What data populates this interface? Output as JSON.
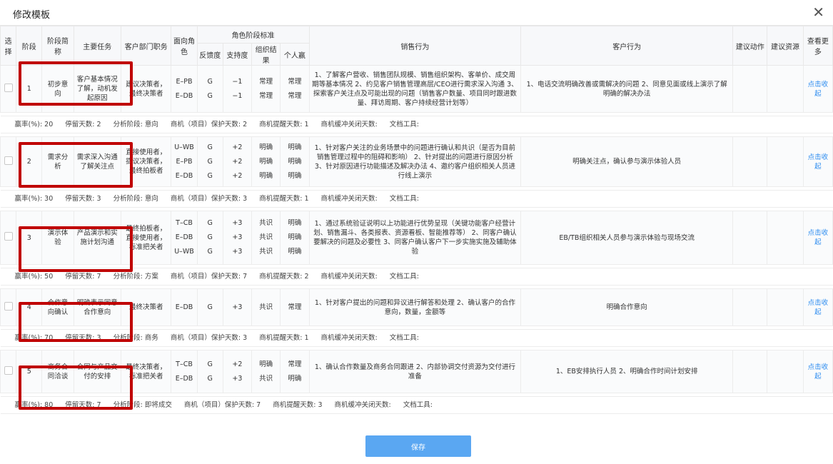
{
  "dialog": {
    "title": "修改模板",
    "close_icon": "close-icon",
    "save_label": "保存"
  },
  "headers": {
    "select": "选择",
    "stage": "阶段",
    "short_name": "阶段简称",
    "main_task": "主要任务",
    "dept_role": "客户部门职务",
    "facing_role": "面向角色",
    "role_standard": "角色阶段标准",
    "feedback": "反馈度",
    "support": "支持度",
    "org_result": "组织结果",
    "personal_win": "个人赢",
    "sales_action": "销售行为",
    "customer_action": "客户行为",
    "suggest_action": "建议动作",
    "suggest_resource": "建议资源",
    "view_more": "查看更多"
  },
  "summary_labels": {
    "win_rate": "赢率(%):",
    "stay_days": "停留天数:",
    "analysis_stage": "分析阶段:",
    "protect_days": "商机（项目）保护天数:",
    "remind_days": "商机提醒天数:",
    "buffer_days": "商机缓冲关闭天数:",
    "doc_tool": "文档工具:"
  },
  "stages": [
    {
      "num": "1",
      "short": "初步意向",
      "task": "客户基本情况了解，动机发起原因",
      "dept": "建议决策者，最终决策者",
      "roles": [
        "E–PB",
        "E–DB"
      ],
      "feedback": [
        "G",
        "G"
      ],
      "support": [
        "−1",
        "−1"
      ],
      "org": [
        "常理",
        "常理"
      ],
      "personal": [
        "常理",
        "常理"
      ],
      "sales": "1、了解客户营收、销售团队规模、销售组织架构、客单价、成交周期等基本情况 2、约见客户销售管理高层/CEO进行需求深入沟通 3、探索客户关注点及可能出现的问题（销售客户数量、项目同时跟进数量、拜访周期、客户持续经营计划等）",
      "customer": "1、电话交流明确改善或需解决的问题 2、同意见面或线上演示了解明确的解决办法",
      "link": "点击收起",
      "summary": {
        "win_rate": "20",
        "stay_days": "2",
        "analysis_stage": "意向",
        "protect_days": "2",
        "remind_days": "1",
        "buffer_days": "",
        "doc_tool": ""
      }
    },
    {
      "num": "2",
      "short": "需求分析",
      "task": "需求深入沟通了解关注点",
      "dept": "直接使用者，提议决策者，最终拍板者",
      "roles": [
        "U–WB",
        "E–PB",
        "E–DB"
      ],
      "feedback": [
        "G",
        "G",
        "G"
      ],
      "support": [
        "+2",
        "+2",
        "+2"
      ],
      "org": [
        "明确",
        "明确",
        "明确"
      ],
      "personal": [
        "明确",
        "明确",
        "明确"
      ],
      "sales": "1、针对客户关注的业务场景中的问题进行确认和共识（是否为目前销售管理过程中的阻碍和影响） 2、针对提出的问题进行原因分析 3、针对原因进行功能描述及解决办法 4、邀约客户组织相关人员进行线上演示",
      "customer": "明确关注点，确认参与演示体验人员",
      "link": "点击收起",
      "summary": {
        "win_rate": "30",
        "stay_days": "3",
        "analysis_stage": "意向",
        "protect_days": "3",
        "remind_days": "1",
        "buffer_days": "",
        "doc_tool": ""
      }
    },
    {
      "num": "3",
      "short": "演示体验",
      "task": "产品演示和实施计划沟通",
      "dept": "最终拍板者，直接使用者，标准把关者",
      "roles": [
        "T–CB",
        "E–DB",
        "U–WB"
      ],
      "feedback": [
        "G",
        "G",
        "G"
      ],
      "support": [
        "+3",
        "+3",
        "+3"
      ],
      "org": [
        "共识",
        "共识",
        "共识"
      ],
      "personal": [
        "明确",
        "明确",
        "明确"
      ],
      "sales": "1、通过系统验证说明以上功能进行优势呈现（关键功能客户经营计划、销售漏斗、各类报表、资源看板、智能推荐等） 2、同客户确认要解决的问题及必要性 3、同客户确认客户下一步实施实施及辅助体验",
      "customer": "EB/TB组织相关人员参与演示体验与现场交流",
      "link": "点击收起",
      "summary": {
        "win_rate": "50",
        "stay_days": "7",
        "analysis_stage": "方案",
        "protect_days": "7",
        "remind_days": "2",
        "buffer_days": "",
        "doc_tool": ""
      }
    },
    {
      "num": "4",
      "short": "合作意向确认",
      "task": "明确表示同意合作意向",
      "dept": "最终决策者",
      "roles": [
        "E–DB"
      ],
      "feedback": [
        "G"
      ],
      "support": [
        "+3"
      ],
      "org": [
        "共识"
      ],
      "personal": [
        "常理"
      ],
      "sales": "1、针对客户提出的问题和异议进行解答和处理 2、确认客户的合作意向，数量，金额等",
      "customer": "明确合作意向",
      "link": "点击收起",
      "summary": {
        "win_rate": "70",
        "stay_days": "3",
        "analysis_stage": "商务",
        "protect_days": "3",
        "remind_days": "1",
        "buffer_days": "",
        "doc_tool": ""
      }
    },
    {
      "num": "5",
      "short": "商务合同洽谈",
      "task": "合同与产品交付的安排",
      "dept": "最终决策者，标准把关者",
      "roles": [
        "T–CB",
        "E–DB"
      ],
      "feedback": [
        "G",
        "G"
      ],
      "support": [
        "+2",
        "+3"
      ],
      "org": [
        "明确",
        "共识"
      ],
      "personal": [
        "常理",
        "明确"
      ],
      "sales": "1、确认合作数量及商务合同跟进 2、内部协调交付资源为交付进行准备",
      "customer": "1、EB安排执行人员 2、明确合作时间计划安排",
      "link": "点击收起",
      "summary": {
        "win_rate": "80",
        "stay_days": "7",
        "analysis_stage": "即将成交",
        "protect_days": "7",
        "remind_days": "3",
        "buffer_days": "",
        "doc_tool": ""
      }
    }
  ]
}
